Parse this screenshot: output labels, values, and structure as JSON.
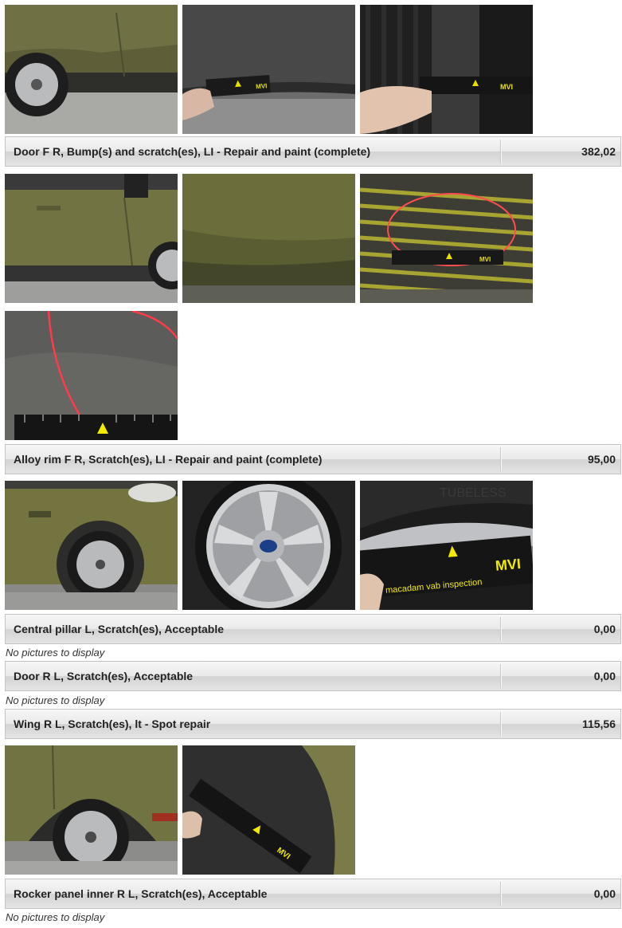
{
  "damages": [
    {
      "description": "Door F R, Bump(s) and scratch(es), LI - Repair and paint (complete)",
      "amount": "382,02"
    },
    {
      "description": "Alloy rim F R, Scratch(es), LI - Repair and paint (complete)",
      "amount": "95,00"
    },
    {
      "description": "Central pillar L, Scratch(es), Acceptable",
      "amount": "0,00",
      "note": "No pictures to display"
    },
    {
      "description": "Door R L, Scratch(es), Acceptable",
      "amount": "0,00",
      "note": "No pictures to display"
    },
    {
      "description": "Wing R L, Scratch(es), lt - Spot repair",
      "amount": "115,56"
    },
    {
      "description": "Rocker panel inner R L, Scratch(es), Acceptable",
      "amount": "0,00",
      "note": "No pictures to display"
    }
  ],
  "ruler_brand": "MVI",
  "ruler_text": "macadam vab inspection",
  "colors": {
    "car_paint": "#6f7040",
    "ruler_mark": "#e8e000",
    "circle_marker": "#ff4040"
  }
}
